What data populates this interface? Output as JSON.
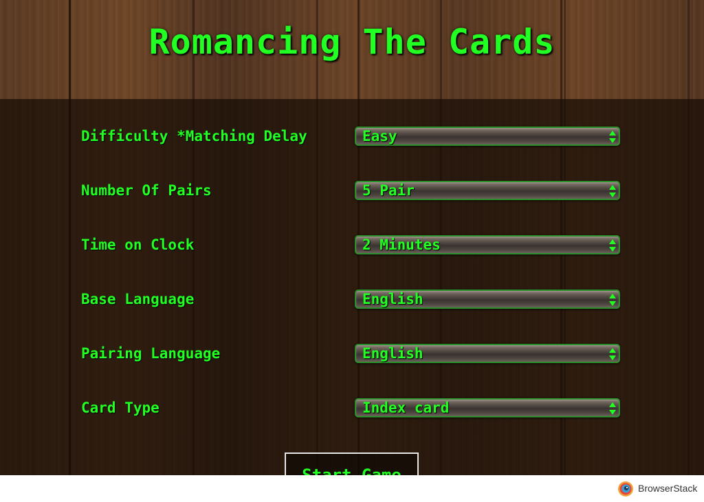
{
  "title": "Romancing The Cards",
  "settings": [
    {
      "label": "Difficulty *Matching Delay",
      "value": "Easy"
    },
    {
      "label": "Number Of Pairs",
      "value": "5 Pair"
    },
    {
      "label": "Time on Clock",
      "value": "2 Minutes"
    },
    {
      "label": "Base Language",
      "value": "English"
    },
    {
      "label": "Pairing Language",
      "value": "English"
    },
    {
      "label": "Card Type",
      "value": "Index card"
    }
  ],
  "start_button_label": "Start Game",
  "footer": {
    "brand": "BrowserStack",
    "logo_icon": "browserstack-logo-icon"
  },
  "colors": {
    "accent": "#22ff22",
    "select_border": "#2a8f2a",
    "wood": "#5a3a22"
  }
}
